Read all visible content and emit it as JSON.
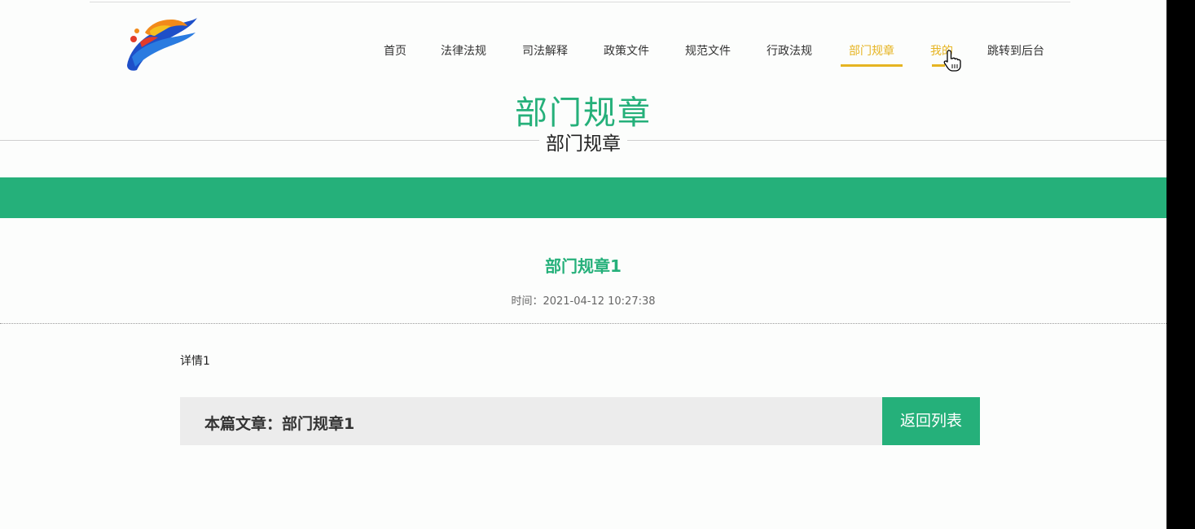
{
  "nav": {
    "items": [
      {
        "label": "首页"
      },
      {
        "label": "法律法规"
      },
      {
        "label": "司法解释"
      },
      {
        "label": "政策文件"
      },
      {
        "label": "规范文件"
      },
      {
        "label": "行政法规"
      },
      {
        "label": "部门规章",
        "state": "active"
      },
      {
        "label": "我的",
        "state": "hover"
      },
      {
        "label": "跳转到后台"
      }
    ]
  },
  "hero": {
    "title": "部门规章",
    "subtitle": "部门规章"
  },
  "article": {
    "title": "部门规章1",
    "time": "时间：2021-04-12 10:27:38",
    "detail": "详情1"
  },
  "footer": {
    "current_label": "本篇文章：部门规章1",
    "back_button": "返回列表"
  },
  "colors": {
    "accent_green": "#25b07a",
    "nav_active": "#e6b422",
    "footer_bg": "#ececec"
  },
  "icons": {
    "logo": "colorful-swirl-logo",
    "cursor": "hand-pointer-icon"
  }
}
